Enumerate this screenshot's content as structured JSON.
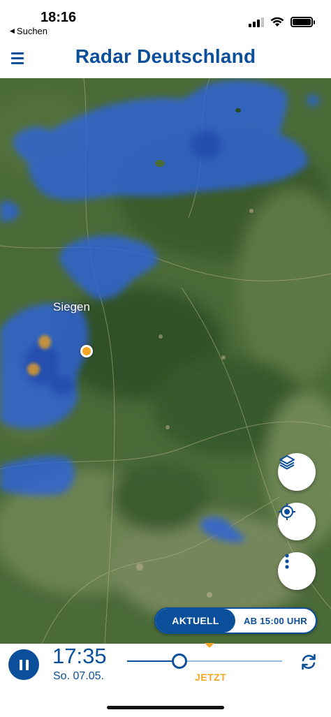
{
  "status_bar": {
    "time": "18:16",
    "back_label": "Suchen",
    "back_icon": "back-arrow-icon",
    "signal_icon": "cellular-signal-icon",
    "wifi_icon": "wifi-icon",
    "battery_icon": "battery-icon",
    "battery_level": 1.0
  },
  "header": {
    "title": "Radar Deutschland",
    "menu_icon": "hamburger-menu-icon"
  },
  "map": {
    "city_label": "Siegen",
    "location_marker_icon": "location-dot-icon",
    "controls": {
      "layers_icon": "layers-icon",
      "locate_icon": "crosshair-locate-icon",
      "more_icon": "more-vertical-icon"
    },
    "mode_toggle": {
      "active_label": "AKTUELL",
      "inactive_label": "AB 15:00 UHR"
    }
  },
  "playback": {
    "time": "17:35",
    "date": "So. 07.05.",
    "now_label": "JETZT",
    "timeline_position": 0.34,
    "pause_icon": "pause-icon",
    "refresh_icon": "refresh-icon"
  },
  "colors": {
    "brand_blue": "#0b4e9a",
    "accent_orange": "#f5a623",
    "rain_blue": "#2f63d8"
  }
}
